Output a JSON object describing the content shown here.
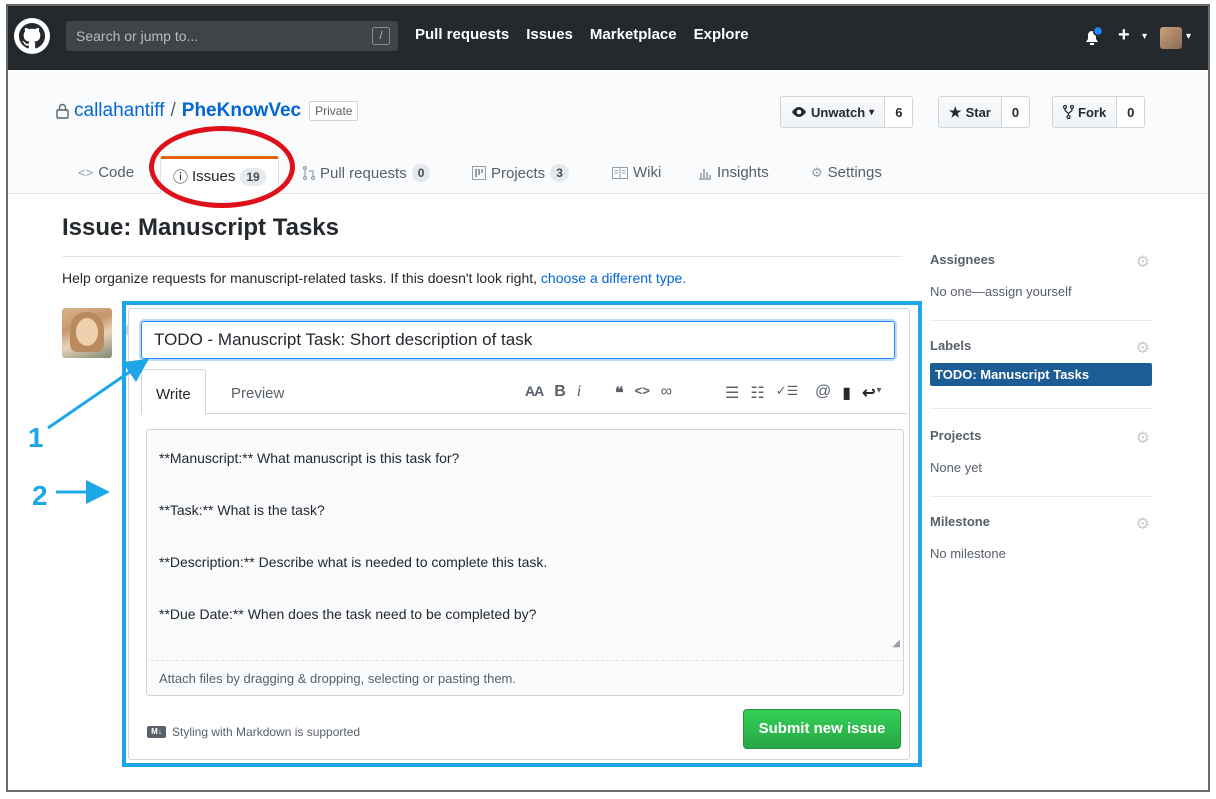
{
  "topnav": {
    "search_placeholder": "Search or jump to...",
    "search_hotkey": "/",
    "links": [
      "Pull requests",
      "Issues",
      "Marketplace",
      "Explore"
    ],
    "new_label": "+",
    "caret": "▾"
  },
  "repo": {
    "owner": "callahantiff",
    "separator": "/",
    "name": "PheKnowVec",
    "visibility": "Private",
    "watch": {
      "label": "Unwatch",
      "count": "6"
    },
    "star": {
      "label": "Star",
      "count": "0"
    },
    "fork": {
      "label": "Fork",
      "count": "0"
    }
  },
  "tabs": {
    "code": {
      "label": "Code",
      "icon": "<>"
    },
    "issues": {
      "label": "Issues",
      "count": "19",
      "icon": "ⓘ"
    },
    "pulls": {
      "label": "Pull requests",
      "count": "0"
    },
    "projects": {
      "label": "Projects",
      "count": "3"
    },
    "wiki": {
      "label": "Wiki"
    },
    "insights": {
      "label": "Insights"
    },
    "settings": {
      "label": "Settings"
    }
  },
  "page": {
    "title": "Issue: Manuscript Tasks",
    "help_text": "Help organize requests for manuscript-related tasks. If this doesn't look right,",
    "help_link": "choose a different type."
  },
  "form": {
    "title_value": "TODO - Manuscript Task: Short description of task",
    "tab_write": "Write",
    "tab_preview": "Preview",
    "body_lines": [
      "**Manuscript:** What manuscript is this task for?",
      "**Task:** What is the task?",
      "**Description:** Describe what is needed to complete this task.",
      "**Due Date:** When does the task need to be completed by?"
    ],
    "attach_text": "Attach files by dragging & dropping, selecting or pasting them.",
    "markdown_note": "Styling with Markdown is supported",
    "markdown_badge": "M↓",
    "submit_label": "Submit new issue",
    "toolbar": {
      "heading": "AA",
      "bold": "B",
      "italic": "i",
      "quote": "❝",
      "code": "<>",
      "link": "∞",
      "ul": "☰",
      "ol": "☷",
      "task": "✓☰",
      "mention": "@",
      "saved": "▮",
      "reply": "↩"
    }
  },
  "sidebar": {
    "assignees": {
      "title": "Assignees",
      "value": "No one—assign yourself"
    },
    "labels": {
      "title": "Labels",
      "value": "TODO: Manuscript Tasks"
    },
    "projects": {
      "title": "Projects",
      "value": "None yet"
    },
    "milestone": {
      "title": "Milestone",
      "value": "No milestone"
    }
  },
  "annotations": {
    "one": "1",
    "two": "2"
  },
  "colors": {
    "accent_blue": "#1ea7e6",
    "highlight_red": "#e0101a",
    "label_bg": "#1b5d94",
    "submit_green": "#28a745"
  }
}
